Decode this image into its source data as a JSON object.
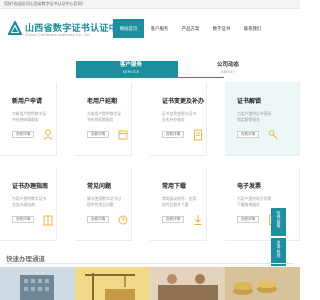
{
  "topbar": {
    "welcome": "您好!欢迎访问山西省数字证书认证中心官网!"
  },
  "header": {
    "brand_cn": "山西省数字证书认证中心",
    "brand_en": "Shanxi Certificate Authority Co., Ltd.",
    "nav": [
      "网站首页",
      "客户服务",
      "产品方案",
      "数字证书",
      "联系我们"
    ],
    "active_nav": 0
  },
  "colors": {
    "accent": "#1e8fa0",
    "brand": "#1a8c9c"
  },
  "tabs": {
    "service": {
      "cn": "客户服务",
      "en": "SERVICE"
    },
    "news": {
      "cn": "公司动态",
      "en": "ABOUT"
    }
  },
  "services": [
    {
      "title": "新用户申请",
      "desc": "为新用户提供数字证书在线申请服务",
      "button": "查看详情",
      "icon": "user-add-icon"
    },
    {
      "title": "老用户延期",
      "desc": "为老用户提供数字证书在线续期服务",
      "button": "查看详情",
      "icon": "calendar-icon"
    },
    {
      "title": "证书变更及补办",
      "desc": "证书信息变更与证书丢失补办服务",
      "button": "查看详情",
      "icon": "document-edit-icon"
    },
    {
      "title": "证书解锁",
      "desc": "为用户提供证书密码锁定解锁服务",
      "button": "查看详情",
      "icon": "key-icon"
    },
    {
      "title": "证书办理指南",
      "desc": "为用户提供数字证书业务办理指南",
      "button": "查看详情",
      "icon": "book-icon"
    },
    {
      "title": "常见问题",
      "desc": "解决使用数字证书过程中的常见问题",
      "button": "查看详情",
      "icon": "question-icon"
    },
    {
      "title": "常用下载",
      "desc": "常用驱动程序、应用软件及相关下载",
      "button": "查看详情",
      "icon": "download-icon"
    },
    {
      "title": "电子发票",
      "desc": "为用户提供电子发票下载查询服务",
      "button": "查看详情",
      "icon": "invoice-icon"
    }
  ],
  "float": {
    "online": "在线客服",
    "hotline": "咨询热线"
  },
  "quick": {
    "title": "快速办理通道"
  }
}
